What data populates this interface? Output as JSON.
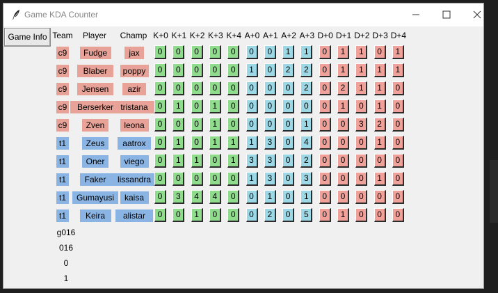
{
  "window": {
    "title": "Game KDA Counter"
  },
  "game_info_button": "Game Info",
  "headers": {
    "team": "Team",
    "player": "Player",
    "champ": "Champ"
  },
  "stat_headers": [
    "K+0",
    "K+1",
    "K+2",
    "K+3",
    "K+4",
    "A+0",
    "A+1",
    "A+2",
    "A+3",
    "D+0",
    "D+1",
    "D+2",
    "D+3",
    "D+4"
  ],
  "rows": [
    {
      "team": "c9",
      "player": "Fudge",
      "champ": "jax",
      "side": "red",
      "stats": [
        0,
        0,
        0,
        0,
        0,
        0,
        0,
        1,
        1,
        0,
        1,
        1,
        0,
        1
      ]
    },
    {
      "team": "c9",
      "player": "Blaber",
      "champ": "poppy",
      "side": "red",
      "stats": [
        0,
        0,
        0,
        0,
        0,
        1,
        0,
        2,
        2,
        0,
        1,
        1,
        1,
        1
      ]
    },
    {
      "team": "c9",
      "player": "Jensen",
      "champ": "azir",
      "side": "red",
      "stats": [
        0,
        0,
        0,
        0,
        0,
        0,
        0,
        0,
        2,
        0,
        2,
        1,
        1,
        0
      ]
    },
    {
      "team": "c9",
      "player": "Berserker",
      "champ": "tristana",
      "side": "red",
      "stats": [
        0,
        1,
        0,
        1,
        0,
        0,
        0,
        0,
        0,
        0,
        1,
        0,
        1,
        0
      ]
    },
    {
      "team": "c9",
      "player": "Zven",
      "champ": "leona",
      "side": "red",
      "stats": [
        0,
        0,
        0,
        1,
        0,
        0,
        0,
        0,
        1,
        0,
        0,
        3,
        2,
        0
      ]
    },
    {
      "team": "t1",
      "player": "Zeus",
      "champ": "aatrox",
      "side": "blue",
      "stats": [
        0,
        1,
        0,
        1,
        1,
        1,
        3,
        0,
        4,
        0,
        0,
        0,
        1,
        0
      ]
    },
    {
      "team": "t1",
      "player": "Oner",
      "champ": "viego",
      "side": "blue",
      "stats": [
        0,
        1,
        1,
        0,
        1,
        3,
        3,
        0,
        2,
        0,
        0,
        0,
        0,
        0
      ]
    },
    {
      "team": "t1",
      "player": "Faker",
      "champ": "lissandra",
      "side": "blue",
      "stats": [
        0,
        0,
        0,
        0,
        0,
        1,
        3,
        0,
        3,
        0,
        0,
        0,
        1,
        0
      ]
    },
    {
      "team": "t1",
      "player": "Gumayusi",
      "champ": "kaisa",
      "side": "blue",
      "stats": [
        0,
        3,
        4,
        4,
        0,
        0,
        1,
        0,
        1,
        0,
        0,
        0,
        0,
        0
      ]
    },
    {
      "team": "t1",
      "player": "Keira",
      "champ": "alistar",
      "side": "blue",
      "stats": [
        0,
        0,
        1,
        0,
        0,
        0,
        2,
        0,
        5,
        0,
        1,
        0,
        0,
        0
      ]
    }
  ],
  "game_info_lines": [
    "g016",
    "016",
    "0",
    "1"
  ],
  "colors": {
    "red_team": "#e8a298",
    "blue_team": "#8ab4e3",
    "kills": "#8fdc8c",
    "assists": "#9cd8e6",
    "deaths": "#f0a29a"
  }
}
